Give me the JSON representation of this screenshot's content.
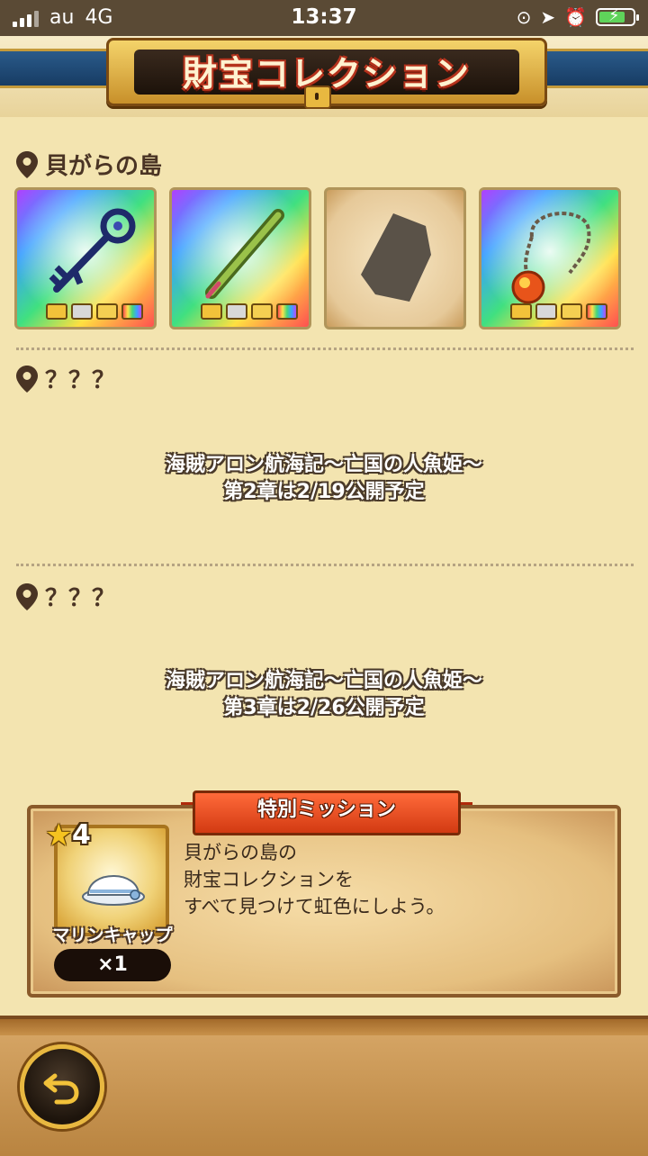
{
  "status_bar": {
    "carrier": "au",
    "network": "4G",
    "time": "13:37"
  },
  "header": {
    "title": "財宝コレクション"
  },
  "sections": [
    {
      "location": "貝がらの島",
      "cards": [
        {
          "state": "rainbow",
          "item_icon": "key-icon"
        },
        {
          "state": "rainbow",
          "item_icon": "pipe-icon"
        },
        {
          "state": "undiscovered",
          "item_icon": "silhouette-icon"
        },
        {
          "state": "rainbow",
          "item_icon": "pendant-icon"
        }
      ]
    },
    {
      "location": "？？？",
      "notice_line1": "海賊アロン航海記～亡国の人魚姫～",
      "notice_line2": "第2章は2/19公開予定"
    },
    {
      "location": "？？？",
      "notice_line1": "海賊アロン航海記～亡国の人魚姫～",
      "notice_line2": "第3章は2/26公開予定"
    }
  ],
  "mission": {
    "title": "特別ミッション",
    "reward_star": "4",
    "reward_name": "マリンキャップ",
    "reward_qty": "×1",
    "desc_line1": "貝がらの島の",
    "desc_line2": "財宝コレクションを",
    "desc_line3": "すべて見つけて虹色にしよう。"
  },
  "colors": {
    "background": "#f3e4b0",
    "text_dark": "#4a3424",
    "accent_red": "#d23a12",
    "gold": "#e8b840"
  }
}
